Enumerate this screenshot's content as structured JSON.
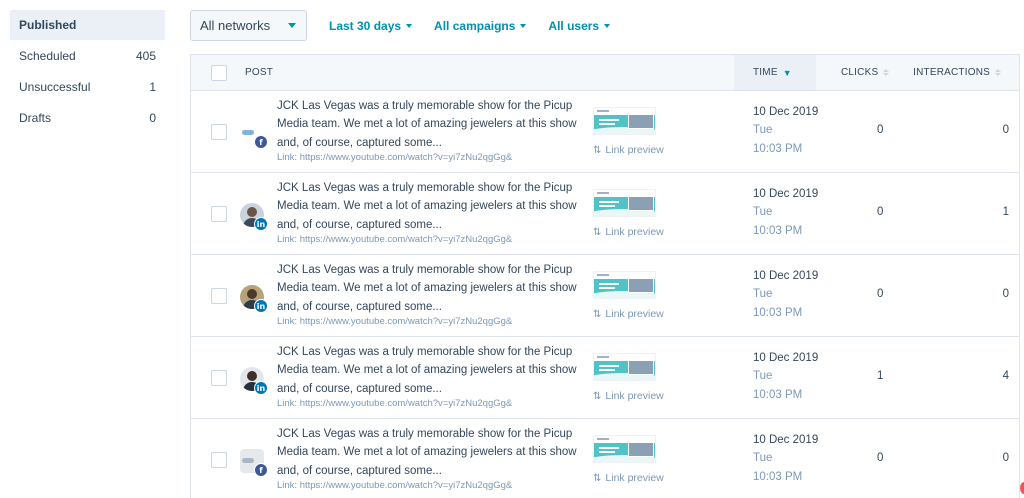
{
  "sidebar": {
    "items": [
      {
        "label": "Published",
        "count": ""
      },
      {
        "label": "Scheduled",
        "count": "405"
      },
      {
        "label": "Unsuccessful",
        "count": "1"
      },
      {
        "label": "Drafts",
        "count": "0"
      }
    ]
  },
  "filters": {
    "network_select": "All networks",
    "date_range": "Last 30 days",
    "campaigns": "All campaigns",
    "users": "All users"
  },
  "table": {
    "headers": {
      "post": "POST",
      "time": "TIME",
      "clicks": "CLICKS",
      "interactions": "INTERACTIONS"
    },
    "preview_label": "Link preview",
    "rows": [
      {
        "network": "facebook",
        "avatar": "company-logo",
        "text": "JCK Las Vegas was a truly memorable show for the Picup Media team. We met a lot of amazing jewelers at this show and, of course, captured some...",
        "link": "Link: https://www.youtube.com/watch?v=yi7zNu2qgGg&",
        "date": "10 Dec 2019",
        "day": "Tue",
        "clock": "10:03 PM",
        "clicks": "0",
        "interactions": "0"
      },
      {
        "network": "linkedin",
        "avatar": "person",
        "text": "JCK Las Vegas was a truly memorable show for the Picup Media team. We met a lot of amazing jewelers at this show and, of course, captured some...",
        "link": "Link: https://www.youtube.com/watch?v=yi7zNu2qgGg&",
        "date": "10 Dec 2019",
        "day": "Tue",
        "clock": "10:03 PM",
        "clicks": "0",
        "interactions": "1"
      },
      {
        "network": "linkedin",
        "avatar": "person",
        "text": "JCK Las Vegas was a truly memorable show for the Picup Media team. We met a lot of amazing jewelers at this show and, of course, captured some...",
        "link": "Link: https://www.youtube.com/watch?v=yi7zNu2qgGg&",
        "date": "10 Dec 2019",
        "day": "Tue",
        "clock": "10:03 PM",
        "clicks": "0",
        "interactions": "0"
      },
      {
        "network": "linkedin",
        "avatar": "person",
        "text": "JCK Las Vegas was a truly memorable show for the Picup Media team. We met a lot of amazing jewelers at this show and, of course, captured some...",
        "link": "Link: https://www.youtube.com/watch?v=yi7zNu2qgGg&",
        "date": "10 Dec 2019",
        "day": "Tue",
        "clock": "10:03 PM",
        "clicks": "1",
        "interactions": "4"
      },
      {
        "network": "facebook",
        "avatar": "company-logo",
        "text": "JCK Las Vegas was a truly memorable show for the Picup Media team. We met a lot of amazing jewelers at this show and, of course, captured some...",
        "link": "Link: https://www.youtube.com/watch?v=yi7zNu2qgGg&",
        "date": "10 Dec 2019",
        "day": "Tue",
        "clock": "10:03 PM",
        "clicks": "0",
        "interactions": "0"
      }
    ]
  },
  "colors": {
    "accent": "#0091ae",
    "text": "#33475b",
    "muted": "#7c98b6",
    "border": "#dfe3eb",
    "facebook": "#3b5998",
    "linkedin": "#0077b5"
  }
}
